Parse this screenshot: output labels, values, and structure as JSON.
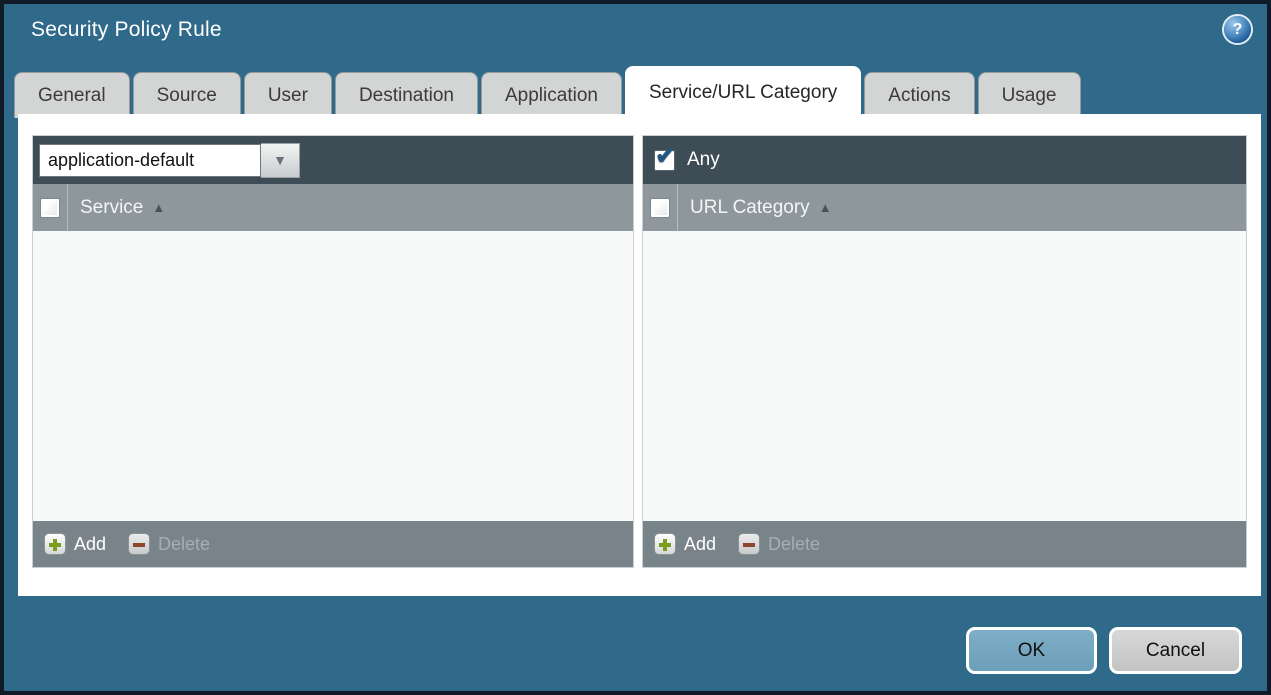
{
  "title": "Security Policy Rule",
  "tabs": [
    {
      "label": "General",
      "active": false
    },
    {
      "label": "Source",
      "active": false
    },
    {
      "label": "User",
      "active": false
    },
    {
      "label": "Destination",
      "active": false
    },
    {
      "label": "Application",
      "active": false
    },
    {
      "label": "Service/URL Category",
      "active": true
    },
    {
      "label": "Actions",
      "active": false
    },
    {
      "label": "Usage",
      "active": false
    }
  ],
  "service_panel": {
    "dropdown": {
      "value": "application-default"
    },
    "header": {
      "column": "Service",
      "sort": "ascending",
      "select_all_checked": false
    },
    "rows": [],
    "footer": {
      "add_label": "Add",
      "delete_label": "Delete",
      "delete_enabled": false
    }
  },
  "url_category_panel": {
    "any_checkbox": {
      "label": "Any",
      "checked": true
    },
    "header": {
      "column": "URL Category",
      "sort": "ascending",
      "select_all_checked": false
    },
    "rows": [],
    "footer": {
      "add_label": "Add",
      "delete_label": "Delete",
      "delete_enabled": false
    }
  },
  "buttons": {
    "ok": "OK",
    "cancel": "Cancel"
  },
  "icons": {
    "help": "?",
    "dropdown_arrow": "▼",
    "sort_asc": "▲",
    "checkmark": "✔"
  },
  "colors": {
    "background_teal": "#2F6A8B",
    "dialog_border": "#111B27",
    "panel_toolbar": "#3D4C55",
    "panel_header": "#8D979C",
    "panel_footer": "#78838A",
    "active_tab_bg": "#FFFFFF",
    "inactive_tab_bg": "#D3D4D4",
    "ok_button": "#74A5BE",
    "cancel_button": "#CBCBCB",
    "add_icon_green": "#7C9B1E",
    "delete_icon_red": "#943A20",
    "help_icon_blue": "#2D6FAE",
    "checkmark_blue": "#26567D"
  }
}
